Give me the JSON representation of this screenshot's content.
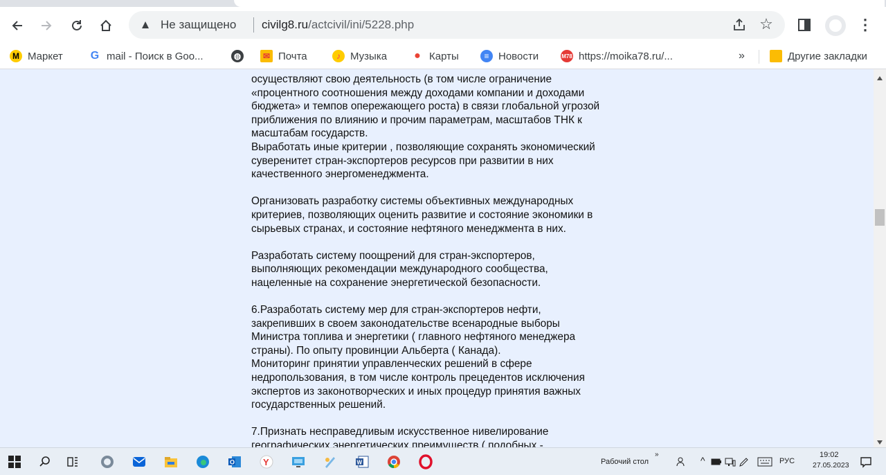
{
  "browser": {
    "security_label": "Не защищено",
    "url_domain": "civilg8.ru",
    "url_path": "/actcivil/ini/5228.php"
  },
  "bookmarks": [
    {
      "label": "Маркет",
      "icon": "yandex-market-icon",
      "color": "#fc3f1d"
    },
    {
      "label": "mail - Поиск в Goo...",
      "icon": "google-icon",
      "color": "#4285f4"
    },
    {
      "label": "",
      "icon": "globe-icon",
      "color": "#3c4043"
    },
    {
      "label": "Почта",
      "icon": "mail-icon",
      "color": "#fbbc04"
    },
    {
      "label": "Музыка",
      "icon": "music-icon",
      "color": "#ffcc00"
    },
    {
      "label": "Карты",
      "icon": "maps-pin-icon",
      "color": "#ea4335"
    },
    {
      "label": "Новости",
      "icon": "news-icon",
      "color": "#4285f4"
    },
    {
      "label": "https://moika78.ru/...",
      "icon": "moika78-icon",
      "color": "#e53935"
    }
  ],
  "bookmarks_more": "»",
  "other_bookmarks": "Другие закладки",
  "article": {
    "paragraphs": [
      {
        "lines": [
          "осуществляют свою деятельность (в том числе ограничение",
          "«процентного соотношения между доходами компании и доходами",
          "бюджета» и темпов опережающего роста) в связи глобальной угрозой",
          "приближения по влиянию и прочим параметрам, масштабов ТНК к",
          "масштабам государств.",
          "Выработать иные критерии , позволяющие сохранять экономический",
          "суверенитет стран-экспортеров ресурсов при развитии в них",
          "качественного энергоменеджмента."
        ]
      },
      {
        "lines": [
          "Организовать разработку системы объективных международных",
          "критериев, позволяющих оценить развитие и состояние экономики в",
          "сырьевых странах, и состояние нефтяного менеджмента в них."
        ]
      },
      {
        "lines": [
          "Разработать систему поощрений для стран-экспортеров,",
          "выполняющих рекомендации международного сообщества,",
          "нацеленные на сохранение энергетической безопасности."
        ]
      },
      {
        "lines": [
          "6.Разработать систему мер для стран-экспортеров нефти,",
          "закрепивших в своем законодательстве всенародные выборы",
          "Министра топлива и энергетики ( главного нефтяного менеджера",
          "страны). По опыту провинции Альберта ( Канада).",
          "Мониторинг принятии управленческих решений в сфере",
          "недропользования, в том числе контроль прецедентов исключения",
          "экспертов из законотворческих и иных процедур принятия важных",
          "государственных решений."
        ]
      },
      {
        "lines": [
          "7.Признать несправедливым искусственное нивелирование",
          "географических энергетических преимуществ ( подобных -"
        ]
      }
    ]
  },
  "taskbar": {
    "desktop_label": "Рабочий стол",
    "language": "РУС",
    "time": "19:02",
    "date": "27.05.2023"
  }
}
